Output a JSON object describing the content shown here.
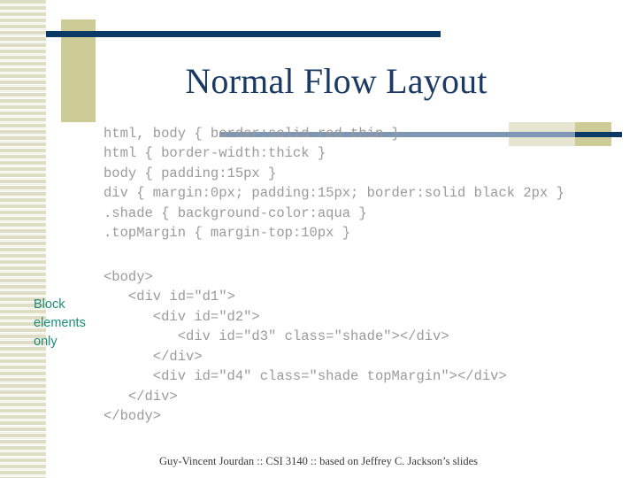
{
  "slide": {
    "title": "Normal Flow Layout",
    "footer": "Guy-Vincent Jourdan :: CSI 3140 :: based on Jeffrey C. Jackson’s slides",
    "annotation": "Block\nelements\nonly",
    "css_code": "html, body { border:solid red thin }\nhtml { border-width:thick }\nbody { padding:15px }\ndiv { margin:0px; padding:15px; border:solid black 2px }\n.shade { background-color:aqua }\n.topMargin { margin-top:10px }",
    "html_code": "<body>\n   <div id=\"d1\">\n      <div id=\"d2\">\n         <div id=\"d3\" class=\"shade\"></div>\n      </div>\n      <div id=\"d4\" class=\"shade topMargin\"></div>\n   </div>\n</body>"
  },
  "colors": {
    "title": "#1b3a63",
    "navy_bar": "#0b3a66",
    "khaki_block": "#cdcc97",
    "cream_block": "#e6e5d1",
    "steel_bar": "#7f97b5",
    "stripe": "#dedcc2",
    "code_text": "#9a9a9a",
    "annotation_text": "#1f8a7a",
    "background": "#ffffff"
  }
}
